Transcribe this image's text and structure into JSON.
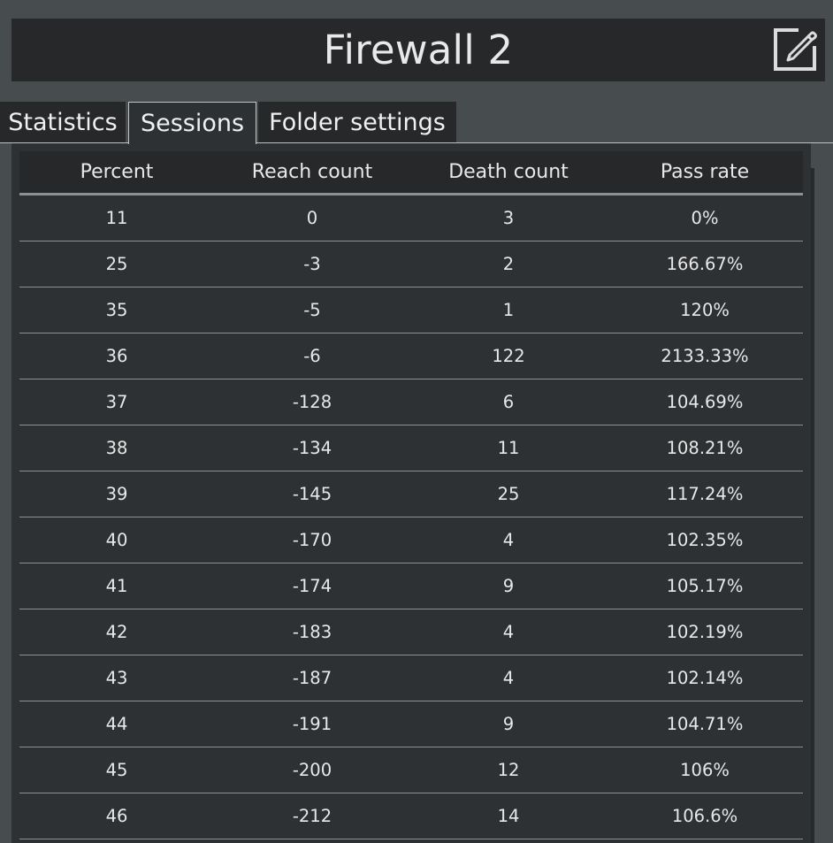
{
  "window": {
    "title": "Firewall 2"
  },
  "tabs": [
    {
      "label": "Statistics",
      "active": false
    },
    {
      "label": "Sessions",
      "active": true
    },
    {
      "label": "Folder settings",
      "active": false
    }
  ],
  "table": {
    "headers": [
      "Percent",
      "Reach count",
      "Death count",
      "Pass rate"
    ],
    "rows": [
      [
        "11",
        "0",
        "3",
        "0%"
      ],
      [
        "25",
        "-3",
        "2",
        "166.67%"
      ],
      [
        "35",
        "-5",
        "1",
        "120%"
      ],
      [
        "36",
        "-6",
        "122",
        "2133.33%"
      ],
      [
        "37",
        "-128",
        "6",
        "104.69%"
      ],
      [
        "38",
        "-134",
        "11",
        "108.21%"
      ],
      [
        "39",
        "-145",
        "25",
        "117.24%"
      ],
      [
        "40",
        "-170",
        "4",
        "102.35%"
      ],
      [
        "41",
        "-174",
        "9",
        "105.17%"
      ],
      [
        "42",
        "-183",
        "4",
        "102.19%"
      ],
      [
        "43",
        "-187",
        "4",
        "102.14%"
      ],
      [
        "44",
        "-191",
        "9",
        "104.71%"
      ],
      [
        "45",
        "-200",
        "12",
        "106%"
      ],
      [
        "46",
        "-212",
        "14",
        "106.6%"
      ]
    ]
  },
  "icons": {
    "edit": "edit-icon"
  },
  "colors": {
    "background": "#474c4f",
    "panel": "#26282a",
    "content": "#2e3134",
    "text": "#e8e8e8",
    "divider": "#8d9194"
  }
}
